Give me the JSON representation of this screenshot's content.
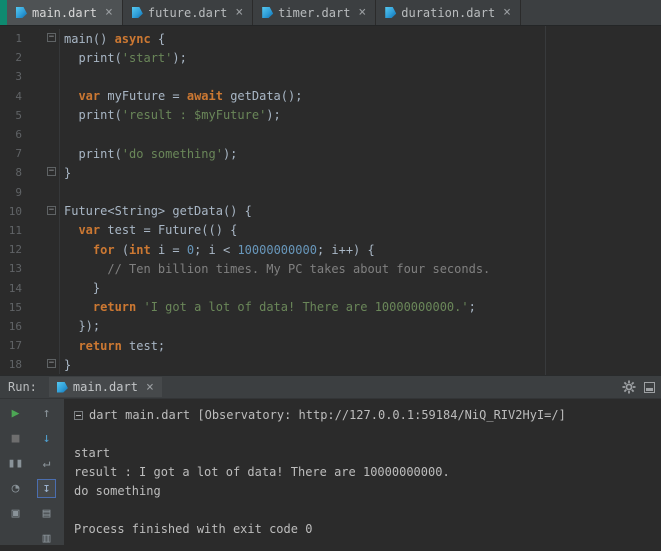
{
  "colors": {
    "editor_bg": "#2b2b2b",
    "panel_bg": "#3c3f41",
    "accent_teal": "#0e8a70",
    "keyword": "#cc7832",
    "string": "#6a8759",
    "number": "#6897bb",
    "comment": "#808080",
    "plain": "#a9b7c6",
    "line_number": "#606366"
  },
  "editor_tabs": [
    {
      "label": "main.dart",
      "close": "×",
      "active": true
    },
    {
      "label": "future.dart",
      "close": "×",
      "active": false
    },
    {
      "label": "timer.dart",
      "close": "×",
      "active": false
    },
    {
      "label": "duration.dart",
      "close": "×",
      "active": false
    }
  ],
  "editor": {
    "lines": [
      {
        "n": "1",
        "fold": true,
        "seg": [
          [
            "p",
            "main() "
          ],
          [
            "k",
            "async"
          ],
          [
            "p",
            " {"
          ]
        ]
      },
      {
        "n": "2",
        "seg": [
          [
            "p",
            "  print("
          ],
          [
            "s",
            "'start'"
          ],
          [
            "p",
            ");"
          ]
        ]
      },
      {
        "n": "3",
        "seg": []
      },
      {
        "n": "4",
        "seg": [
          [
            "p",
            "  "
          ],
          [
            "k",
            "var"
          ],
          [
            "p",
            " myFuture = "
          ],
          [
            "k",
            "await"
          ],
          [
            "p",
            " getData();"
          ]
        ]
      },
      {
        "n": "5",
        "seg": [
          [
            "p",
            "  print("
          ],
          [
            "s",
            "'result : $myFuture'"
          ],
          [
            "p",
            ");"
          ]
        ]
      },
      {
        "n": "6",
        "seg": []
      },
      {
        "n": "7",
        "seg": [
          [
            "p",
            "  print("
          ],
          [
            "s",
            "'do something'"
          ],
          [
            "p",
            ");"
          ]
        ]
      },
      {
        "n": "8",
        "fold": true,
        "seg": [
          [
            "p",
            "}"
          ]
        ]
      },
      {
        "n": "9",
        "seg": []
      },
      {
        "n": "10",
        "fold": true,
        "seg": [
          [
            "p",
            "Future<String> getData() {"
          ]
        ]
      },
      {
        "n": "11",
        "seg": [
          [
            "p",
            "  "
          ],
          [
            "k",
            "var"
          ],
          [
            "p",
            " test = Future(() {"
          ]
        ]
      },
      {
        "n": "12",
        "seg": [
          [
            "p",
            "    "
          ],
          [
            "k",
            "for"
          ],
          [
            "p",
            " ("
          ],
          [
            "k",
            "int"
          ],
          [
            "p",
            " i = "
          ],
          [
            "n",
            "0"
          ],
          [
            "p",
            "; i < "
          ],
          [
            "n",
            "10000000000"
          ],
          [
            "p",
            "; i++) {"
          ]
        ]
      },
      {
        "n": "13",
        "seg": [
          [
            "p",
            "      "
          ],
          [
            "c",
            "// Ten billion times. My PC takes about four seconds."
          ]
        ]
      },
      {
        "n": "14",
        "seg": [
          [
            "p",
            "    }"
          ]
        ]
      },
      {
        "n": "15",
        "seg": [
          [
            "p",
            "    "
          ],
          [
            "k",
            "return"
          ],
          [
            "p",
            " "
          ],
          [
            "s",
            "'I got a lot of data! There are 10000000000.'"
          ],
          [
            "p",
            ";"
          ]
        ]
      },
      {
        "n": "16",
        "seg": [
          [
            "p",
            "  });"
          ]
        ]
      },
      {
        "n": "17",
        "seg": [
          [
            "p",
            "  "
          ],
          [
            "k",
            "return"
          ],
          [
            "p",
            " test;"
          ]
        ]
      },
      {
        "n": "18",
        "fold": true,
        "seg": [
          [
            "p",
            "}"
          ]
        ]
      }
    ]
  },
  "run_panel": {
    "label": "Run:",
    "tab_label": "main.dart",
    "tab_close": "×",
    "console_lines": [
      {
        "icon": true,
        "text": "dart main.dart [Observatory: http://127.0.0.1:59184/NiQ_RIV2HyI=/]"
      },
      {
        "text": ""
      },
      {
        "text": "start"
      },
      {
        "text": "result : I got a lot of data! There are 10000000000."
      },
      {
        "text": "do something"
      },
      {
        "text": ""
      },
      {
        "text": "Process finished with exit code 0"
      }
    ],
    "toolbar_col1": [
      {
        "name": "rerun-button",
        "glyph": "▶",
        "color": "#4ca654"
      },
      {
        "name": "stop-button",
        "glyph": "■",
        "color": "#6e6e6e"
      },
      {
        "name": "pause-output-button",
        "glyph": "▮▮",
        "color": "#8a9399"
      },
      {
        "name": "show-history-button",
        "glyph": "◔",
        "color": "#8a9399"
      },
      {
        "name": "restore-layout-button",
        "glyph": "▣",
        "color": "#8a9399"
      }
    ],
    "toolbar_col2": [
      {
        "name": "up-stack-trace-button",
        "glyph": "↑",
        "color": "#8a9399"
      },
      {
        "name": "down-stack-trace-button",
        "glyph": "↓",
        "color": "#4f9ecd"
      },
      {
        "name": "soft-wrap-button",
        "glyph": "↵",
        "color": "#8a9399"
      },
      {
        "name": "scroll-to-end-button",
        "glyph": "↧",
        "color": "#9db4d0",
        "boxed": true
      },
      {
        "name": "print-console-button",
        "glyph": "▤",
        "color": "#8a9399"
      },
      {
        "name": "clear-all-button",
        "glyph": "▥",
        "color": "#8a9399"
      }
    ]
  }
}
